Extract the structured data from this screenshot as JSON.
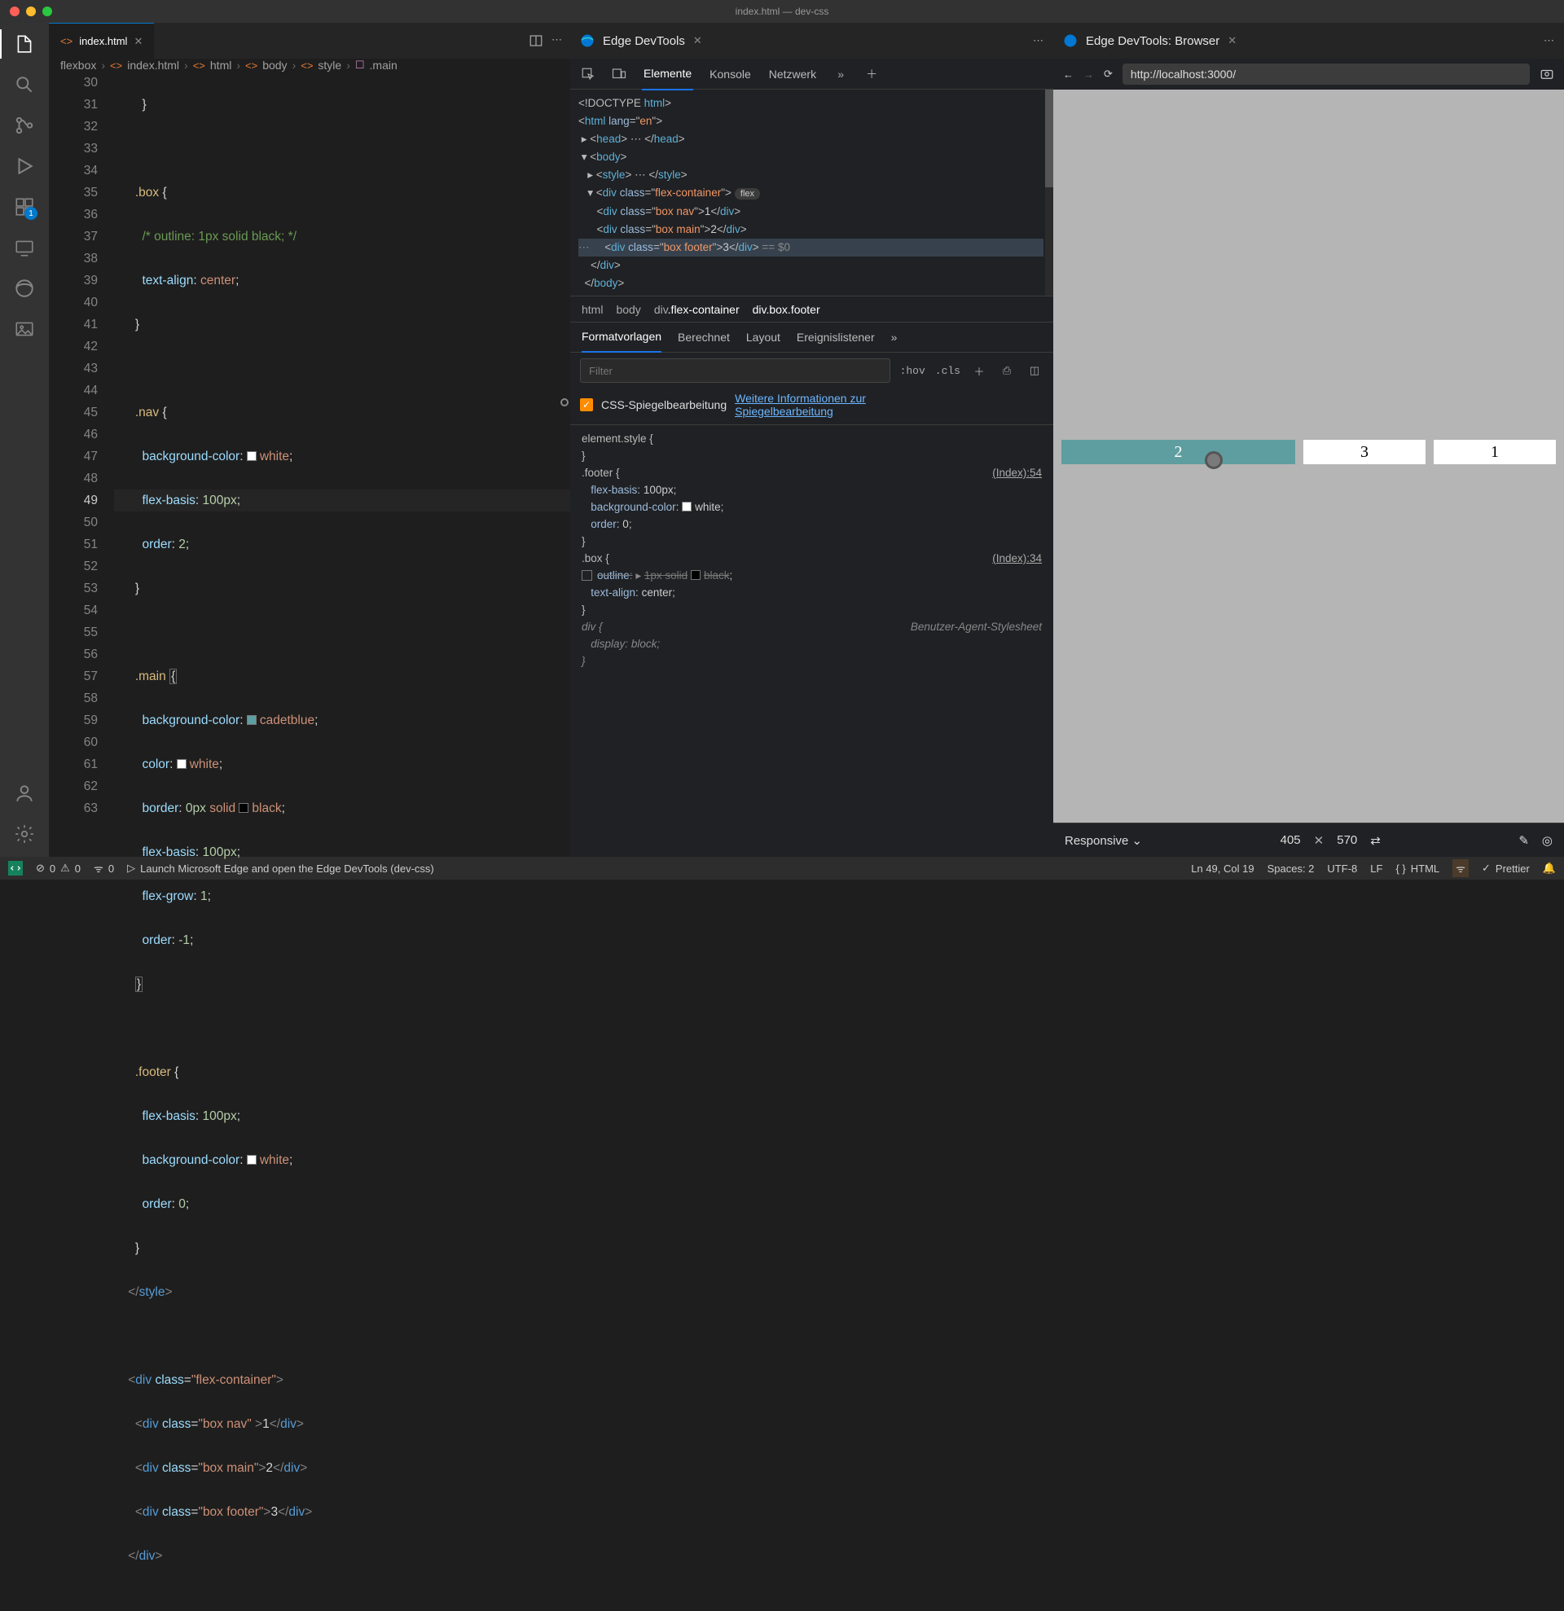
{
  "window": {
    "title": "index.html — dev-css"
  },
  "activitybar": {
    "badge": "1"
  },
  "editor": {
    "tab": {
      "name": "index.html"
    },
    "breadcrumb": [
      "flexbox",
      "index.html",
      "html",
      "body",
      "style",
      ".main"
    ],
    "gutter_start": 30,
    "gutter_end": 63
  },
  "devtools": {
    "title": "Edge DevTools",
    "toolbar": [
      "Elemente",
      "Konsole",
      "Netzwerk"
    ],
    "dom_crumbs": [
      "html",
      "body",
      "div.flex-container",
      "div.box.footer"
    ],
    "style_tabs": [
      "Formatvorlagen",
      "Berechnet",
      "Layout",
      "Ereignislistener"
    ],
    "filter_placeholder": "Filter",
    "hov": ":hov",
    "cls": ".cls",
    "mirror_label": "CSS-Spiegelbearbeitung",
    "mirror_link": "Weitere Informationen zur Spiegelbearbeitung",
    "rules": {
      "element_style": "element.style {",
      "footer_sel": ".footer {",
      "footer_src": "(Index):54",
      "footer_p1": "flex-basis",
      "footer_v1": "100px",
      "footer_p2": "background-color",
      "footer_v2": "white",
      "footer_p3": "order",
      "footer_v3": "0",
      "box_sel": ".box {",
      "box_src": "(Index):34",
      "box_p1": "outline",
      "box_v1": "1px solid",
      "box_v1b": "black",
      "box_p2": "text-align",
      "box_v2": "center",
      "div_sel": "div {",
      "ua": "Benutzer-Agent-Stylesheet",
      "div_p1": "display",
      "div_v1": "block"
    }
  },
  "browser": {
    "title": "Edge DevTools: Browser",
    "url": "http://localhost:3000/",
    "boxes": {
      "main": "2",
      "footer": "3",
      "nav": "1"
    },
    "device": "Responsive",
    "w": "405",
    "h": "570"
  },
  "status": {
    "err": "0",
    "warn": "0",
    "port": "0",
    "launch": "Launch Microsoft Edge and open the Edge DevTools (dev-css)",
    "pos": "Ln 49, Col 19",
    "spaces": "Spaces: 2",
    "enc": "UTF-8",
    "eol": "LF",
    "lang": "HTML",
    "prettier": "Prettier"
  }
}
